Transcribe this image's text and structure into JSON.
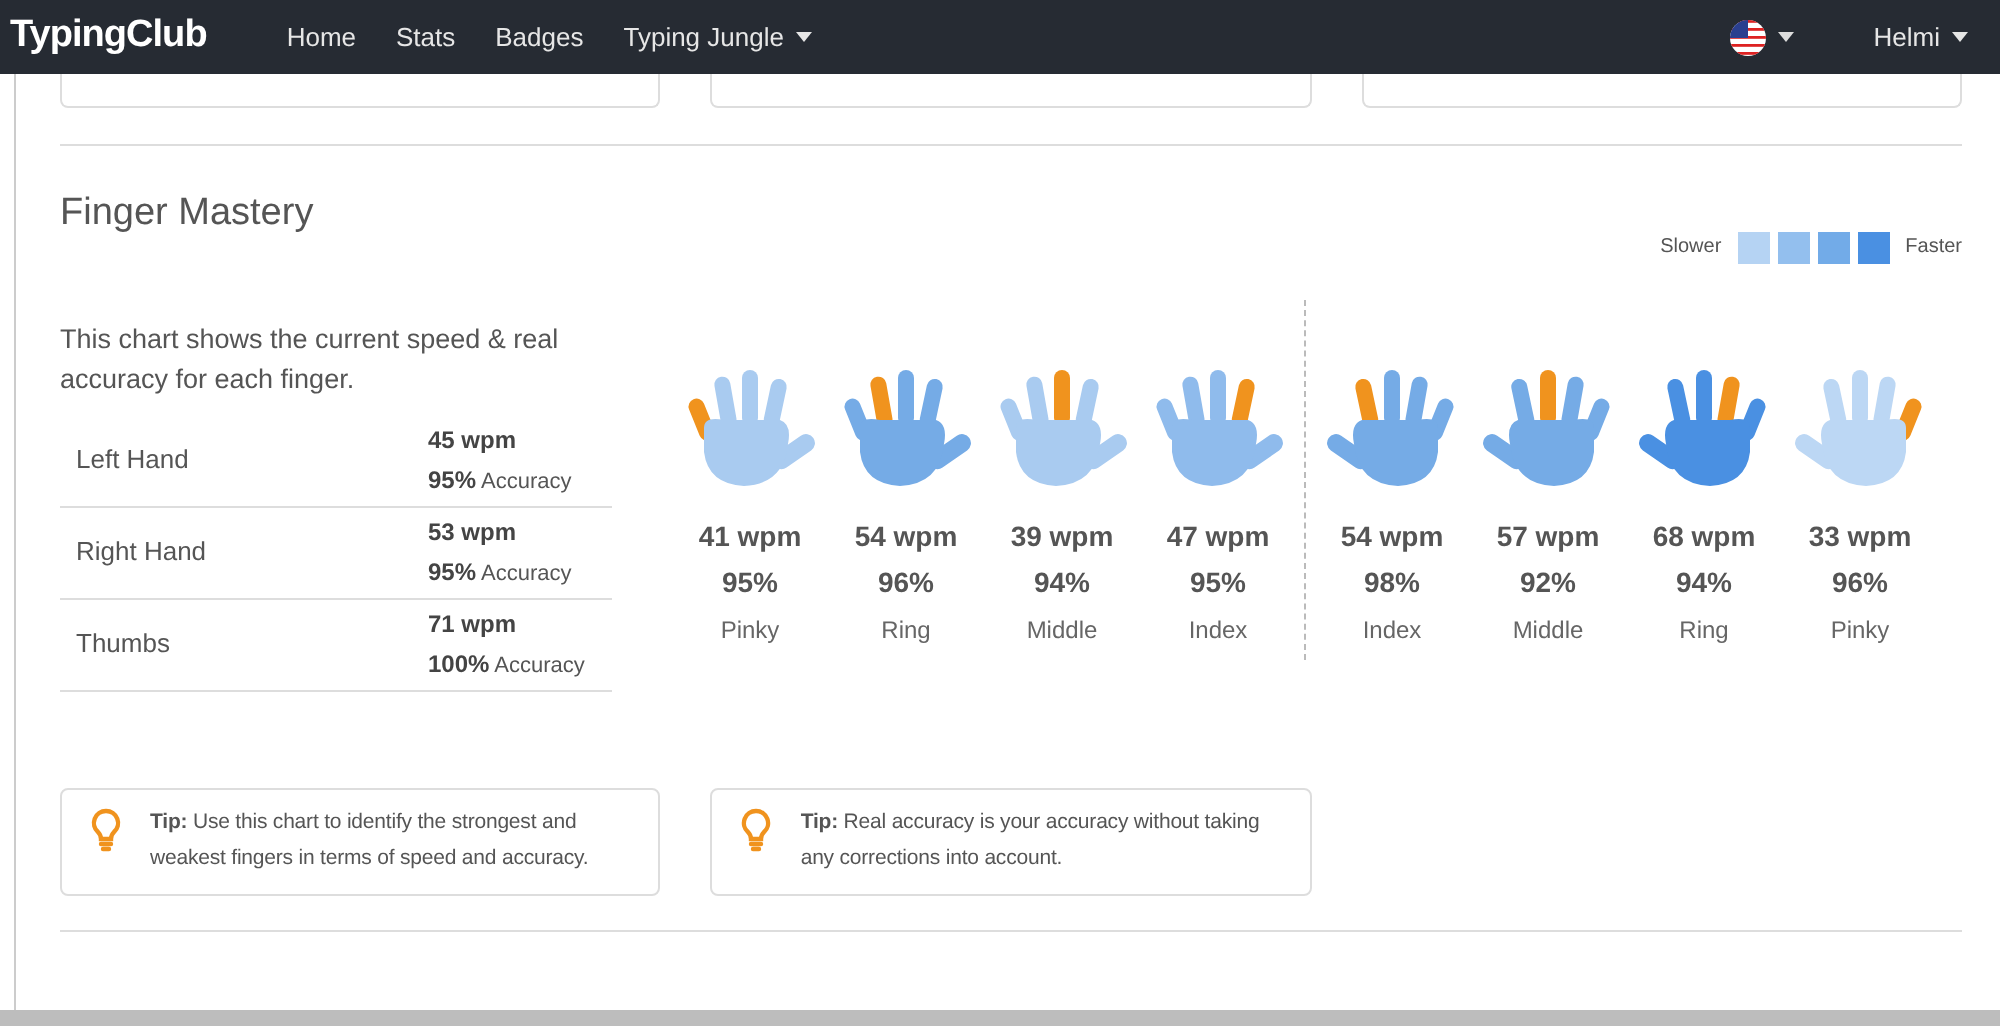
{
  "navbar": {
    "brand": "TypingClub",
    "links": [
      {
        "label": "Home",
        "dropdown": false
      },
      {
        "label": "Stats",
        "dropdown": false
      },
      {
        "label": "Badges",
        "dropdown": false
      },
      {
        "label": "Typing Jungle",
        "dropdown": true
      }
    ],
    "user": "Helmi"
  },
  "section": {
    "title": "Finger Mastery",
    "legend": {
      "slower": "Slower",
      "faster": "Faster",
      "swatches": [
        {
          "color": "#b5d3f3"
        },
        {
          "color": "#93bfee"
        },
        {
          "color": "#72abe8"
        },
        {
          "color": "#4a90e2"
        }
      ]
    },
    "description": "This chart shows the current speed & real accuracy for each finger.",
    "summary": [
      {
        "label": "Left Hand",
        "wpm": "45 wpm",
        "accuracy": "95%",
        "accuracy_label": "Accuracy"
      },
      {
        "label": "Right Hand",
        "wpm": "53 wpm",
        "accuracy": "95%",
        "accuracy_label": "Accuracy"
      },
      {
        "label": "Thumbs",
        "wpm": "71 wpm",
        "accuracy": "100%",
        "accuracy_label": "Accuracy"
      }
    ],
    "left_hand": [
      {
        "kind": "pinky",
        "color": "#a9cbf0",
        "wpm": "41 wpm",
        "accuracy": "95%",
        "label": "Pinky"
      },
      {
        "kind": "ring",
        "color": "#75abe6",
        "wpm": "54 wpm",
        "accuracy": "96%",
        "label": "Ring"
      },
      {
        "kind": "middle",
        "color": "#a9cbf0",
        "wpm": "39 wpm",
        "accuracy": "94%",
        "label": "Middle"
      },
      {
        "kind": "index",
        "color": "#8fbbec",
        "wpm": "47 wpm",
        "accuracy": "95%",
        "label": "Index"
      }
    ],
    "right_hand": [
      {
        "kind": "index",
        "color": "#75abe6",
        "wpm": "54 wpm",
        "accuracy": "98%",
        "label": "Index"
      },
      {
        "kind": "middle",
        "color": "#75abe6",
        "wpm": "57 wpm",
        "accuracy": "92%",
        "label": "Middle"
      },
      {
        "kind": "ring",
        "color": "#4a90e2",
        "wpm": "68 wpm",
        "accuracy": "94%",
        "label": "Ring"
      },
      {
        "kind": "pinky",
        "color": "#bcd7f4",
        "wpm": "33 wpm",
        "accuracy": "96%",
        "label": "Pinky"
      }
    ],
    "tips": [
      {
        "text": "**Tip:** Use this chart to identify the strongest and weakest fingers in terms of speed and accuracy."
      },
      {
        "text": "**Tip:** Real accuracy is your accuracy without taking any corrections into account."
      }
    ]
  }
}
